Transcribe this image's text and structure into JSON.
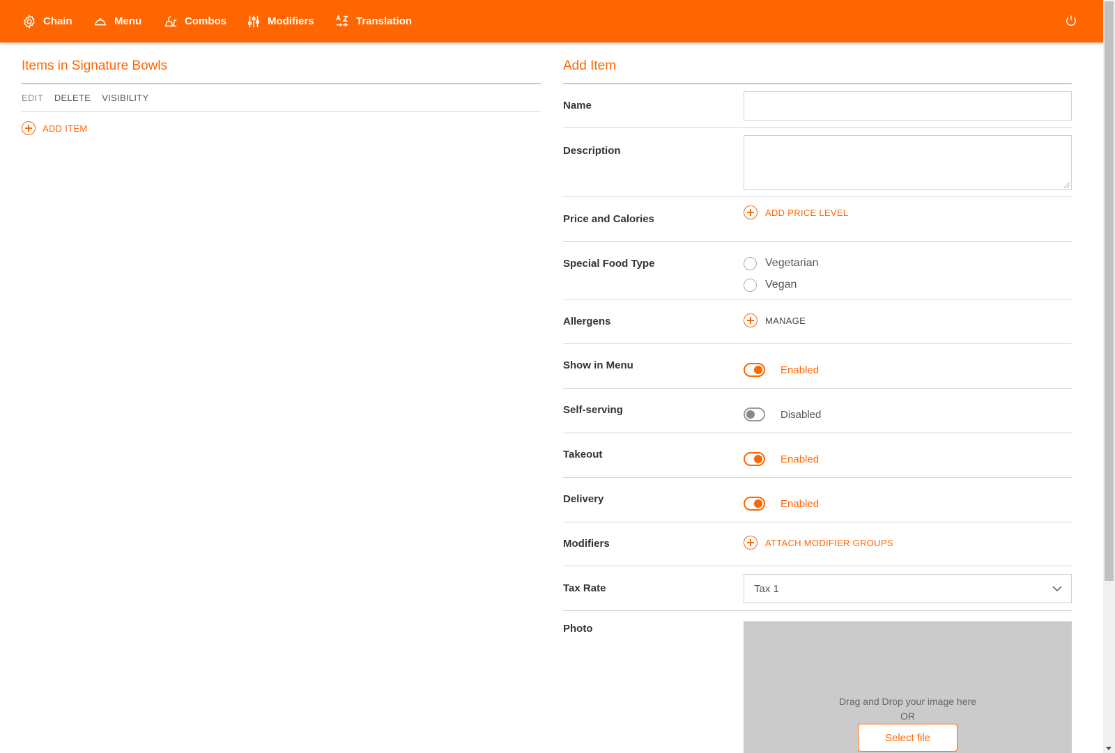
{
  "nav": {
    "items": [
      {
        "label": "Chain",
        "icon": "gear-icon"
      },
      {
        "label": "Menu",
        "icon": "cloche-icon"
      },
      {
        "label": "Combos",
        "icon": "combo-icon"
      },
      {
        "label": "Modifiers",
        "icon": "sliders-icon"
      },
      {
        "label": "Translation",
        "icon": "translate-icon"
      }
    ],
    "power_icon": "power-icon"
  },
  "left": {
    "title": "Items in Signature Bowls",
    "actions": [
      "EDIT",
      "DELETE",
      "VISIBILITY"
    ],
    "add_item_label": "ADD ITEM"
  },
  "right": {
    "title": "Add Item",
    "fields": {
      "name": {
        "label": "Name",
        "value": ""
      },
      "description": {
        "label": "Description",
        "value": ""
      },
      "price": {
        "label": "Price and Calories",
        "action": "ADD PRICE LEVEL"
      },
      "special": {
        "label": "Special Food Type",
        "options": [
          "Vegetarian",
          "Vegan"
        ]
      },
      "allergens": {
        "label": "Allergens",
        "action": "MANAGE"
      },
      "show_in_menu": {
        "label": "Show in Menu",
        "state": "Enabled"
      },
      "self_serving": {
        "label": "Self-serving",
        "state": "Disabled"
      },
      "takeout": {
        "label": "Takeout",
        "state": "Enabled"
      },
      "delivery": {
        "label": "Delivery",
        "state": "Enabled"
      },
      "modifiers": {
        "label": "Modifiers",
        "action": "ATTACH MODIFIER GROUPS"
      },
      "tax_rate": {
        "label": "Tax Rate",
        "value": "Tax 1"
      },
      "photo": {
        "label": "Photo",
        "drop_text": "Drag and Drop your image here",
        "or_text": "OR",
        "button": "Select file"
      }
    }
  },
  "colors": {
    "accent": "#ff6600",
    "divider": "#d7d7d7",
    "dropzone": "#cbcbcb"
  }
}
